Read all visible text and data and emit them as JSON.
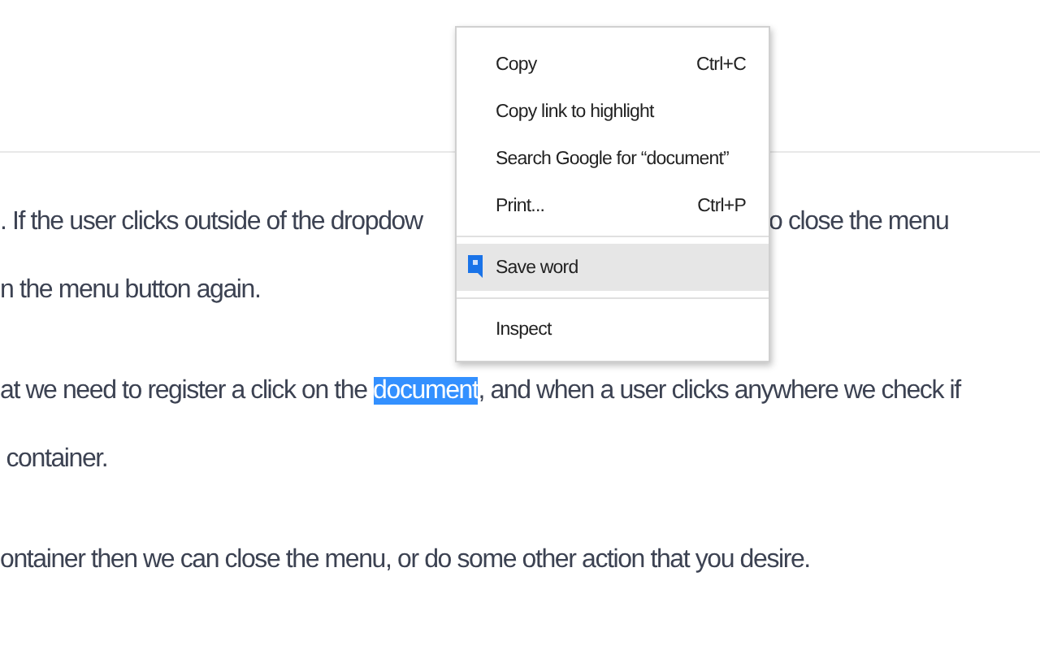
{
  "paragraphs": [
    {
      "lines": [
        [
          {
            "kind": "text",
            "text": ". If the user clicks outside of the dropdow"
          },
          {
            "kind": "after_menu",
            "text": "o close the menu"
          }
        ],
        [
          {
            "kind": "text",
            "text": "n the menu button again."
          }
        ]
      ]
    },
    {
      "lines": [
        [
          {
            "kind": "text",
            "text": "at we need to register a click on the "
          },
          {
            "kind": "selection",
            "text": "document"
          },
          {
            "kind": "text",
            "text": ", and when a user clicks anywhere we check if"
          }
        ],
        [
          {
            "kind": "text",
            "text": " container."
          }
        ]
      ]
    },
    {
      "lines": [
        [
          {
            "kind": "text",
            "text": "ontainer then we can close the menu, or do some other action that you desire."
          }
        ]
      ]
    }
  ],
  "context_menu": {
    "items": [
      {
        "kind": "item",
        "label": "Copy",
        "shortcut": "Ctrl+C",
        "selected": false
      },
      {
        "kind": "item",
        "label": "Copy link to highlight",
        "selected": false
      },
      {
        "kind": "item",
        "label": "Search Google for “document”",
        "selected": false
      },
      {
        "kind": "item",
        "label": "Print...",
        "shortcut": "Ctrl+P",
        "selected": false
      },
      {
        "kind": "separator"
      },
      {
        "kind": "icon_item",
        "label": "Save word",
        "selected": true
      },
      {
        "kind": "separator"
      },
      {
        "kind": "item",
        "label": "Inspect",
        "selected": false
      }
    ]
  }
}
